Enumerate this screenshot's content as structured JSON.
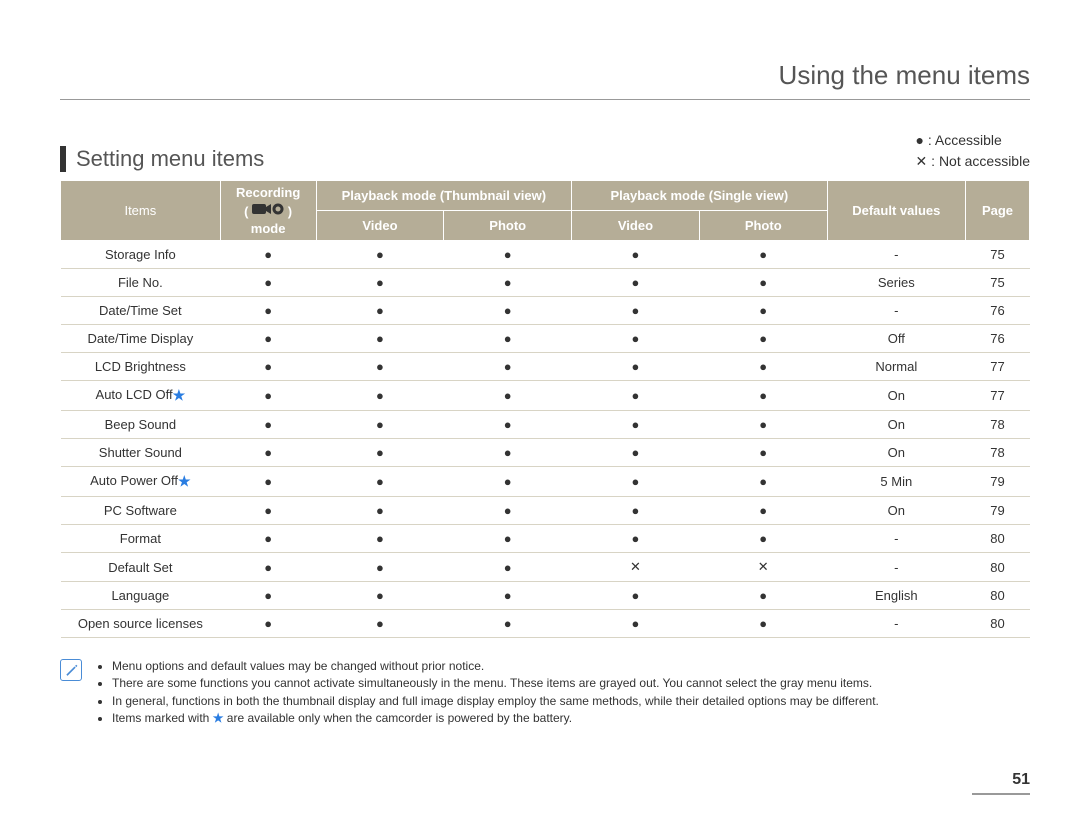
{
  "page_title": "Using the menu items",
  "section_title": "Setting menu items",
  "legend": {
    "accessible": "● : Accessible",
    "not_accessible": "✕ : Not accessible"
  },
  "headers": {
    "items": "Items",
    "recording_top": "Recording",
    "recording_bottom": "mode",
    "pb_thumb": "Playback mode (Thumbnail view)",
    "pb_single": "Playback mode (Single view)",
    "video": "Video",
    "photo": "Photo",
    "default": "Default values",
    "page": "Page"
  },
  "symbols": {
    "dot": "●",
    "cross": "✕",
    "dash": "-"
  },
  "rows": [
    {
      "name": "Storage Info",
      "star": false,
      "c": [
        "d",
        "d",
        "d",
        "d",
        "d"
      ],
      "def": "-",
      "page": "75"
    },
    {
      "name": "File No.",
      "star": false,
      "c": [
        "d",
        "d",
        "d",
        "d",
        "d"
      ],
      "def": "Series",
      "page": "75"
    },
    {
      "name": "Date/Time Set",
      "star": false,
      "c": [
        "d",
        "d",
        "d",
        "d",
        "d"
      ],
      "def": "-",
      "page": "76"
    },
    {
      "name": "Date/Time Display",
      "star": false,
      "c": [
        "d",
        "d",
        "d",
        "d",
        "d"
      ],
      "def": "Off",
      "page": "76"
    },
    {
      "name": "LCD Brightness",
      "star": false,
      "c": [
        "d",
        "d",
        "d",
        "d",
        "d"
      ],
      "def": "Normal",
      "page": "77"
    },
    {
      "name": "Auto LCD Off",
      "star": true,
      "c": [
        "d",
        "d",
        "d",
        "d",
        "d"
      ],
      "def": "On",
      "page": "77"
    },
    {
      "name": "Beep Sound",
      "star": false,
      "c": [
        "d",
        "d",
        "d",
        "d",
        "d"
      ],
      "def": "On",
      "page": "78"
    },
    {
      "name": "Shutter Sound",
      "star": false,
      "c": [
        "d",
        "d",
        "d",
        "d",
        "d"
      ],
      "def": "On",
      "page": "78"
    },
    {
      "name": "Auto Power Off",
      "star": true,
      "c": [
        "d",
        "d",
        "d",
        "d",
        "d"
      ],
      "def": "5 Min",
      "page": "79"
    },
    {
      "name": "PC Software",
      "star": false,
      "c": [
        "d",
        "d",
        "d",
        "d",
        "d"
      ],
      "def": "On",
      "page": "79"
    },
    {
      "name": "Format",
      "star": false,
      "c": [
        "d",
        "d",
        "d",
        "d",
        "d"
      ],
      "def": "-",
      "page": "80"
    },
    {
      "name": "Default Set",
      "star": false,
      "c": [
        "d",
        "d",
        "d",
        "x",
        "x"
      ],
      "def": "-",
      "page": "80"
    },
    {
      "name": "Language",
      "star": false,
      "c": [
        "d",
        "d",
        "d",
        "d",
        "d"
      ],
      "def": "English",
      "page": "80"
    },
    {
      "name": "Open source licenses",
      "star": false,
      "c": [
        "d",
        "d",
        "d",
        "d",
        "d"
      ],
      "def": "-",
      "page": "80"
    }
  ],
  "footnotes": [
    "Menu options and default values may be changed without prior notice.",
    "There are some functions you cannot activate simultaneously in the menu. These items are grayed out. You cannot select the gray menu items.",
    "In general, functions in both the thumbnail display and full image display employ the same methods, while their detailed options may be different.",
    "Items marked with ★ are available only when the camcorder is powered by the battery."
  ],
  "page_number": "51"
}
